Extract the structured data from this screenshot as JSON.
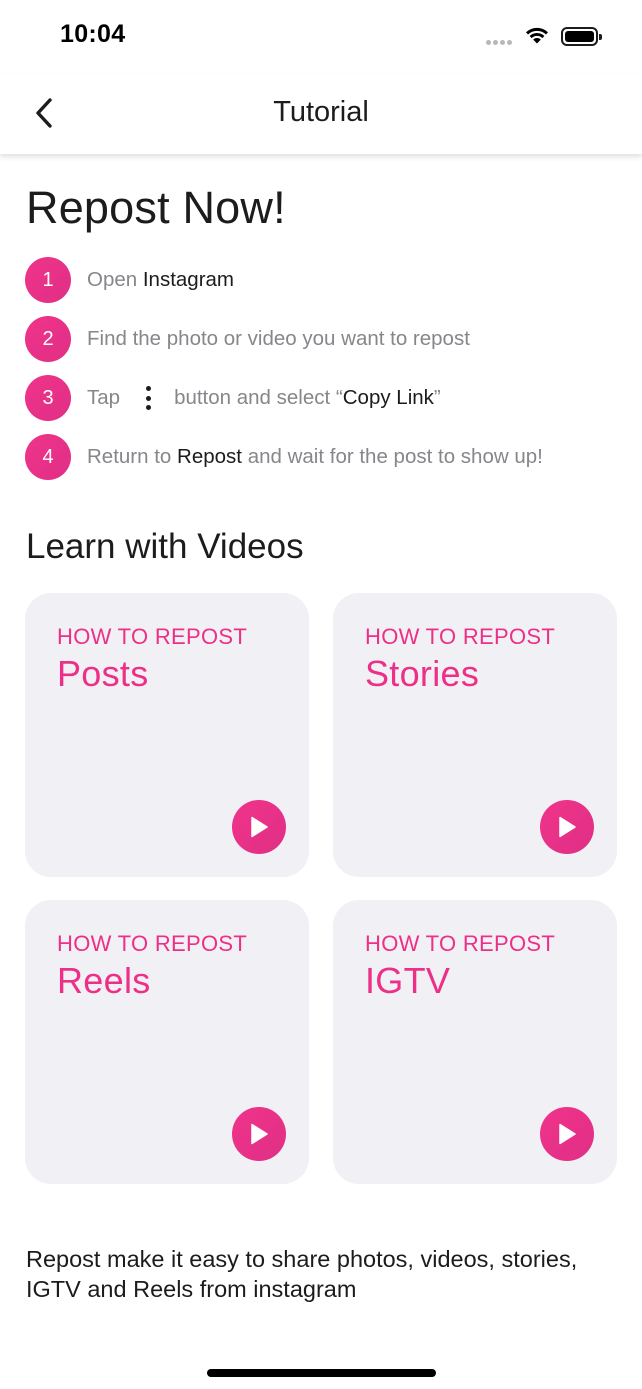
{
  "status_bar": {
    "time": "10:04"
  },
  "nav": {
    "title": "Tutorial",
    "back_icon": "chevron-left-icon"
  },
  "heading": "Repost Now!",
  "steps": [
    {
      "number": "1",
      "text_prefix": "Open ",
      "text_bold": "Instagram"
    },
    {
      "number": "2",
      "text": "Find the photo or video you want to repost"
    },
    {
      "number": "3",
      "text_prefix": "Tap",
      "icon": "more-vertical-icon",
      "text_middle": "button and select “",
      "text_bold": "Copy Link",
      "text_suffix": "”"
    },
    {
      "number": "4",
      "text_prefix": "Return to ",
      "text_bold": "Repost",
      "text_suffix": " and wait for the post to show up!"
    }
  ],
  "videos_section": {
    "title": "Learn with Videos",
    "cards": [
      {
        "kicker": "HOW TO REPOST",
        "title": "Posts"
      },
      {
        "kicker": "HOW TO REPOST",
        "title": "Stories"
      },
      {
        "kicker": "HOW TO REPOST",
        "title": "Reels"
      },
      {
        "kicker": "HOW TO REPOST",
        "title": "IGTV"
      }
    ]
  },
  "footer": {
    "text": "Repost make it easy to share photos, videos, stories, IGTV and Reels from instagram"
  },
  "colors": {
    "accent": "#ee2f87",
    "card_background": "#f0f0f5",
    "muted_text": "#86868b"
  }
}
